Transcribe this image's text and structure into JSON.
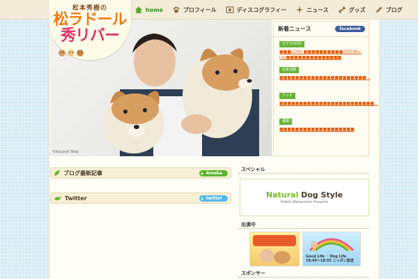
{
  "logo": {
    "sub": "松本秀樹の",
    "line1": "松ラドール",
    "line2": "秀リバー"
  },
  "nav": {
    "items": [
      {
        "label": "home",
        "icon": "home-icon"
      },
      {
        "label": "プロフィール",
        "icon": "paw-icon"
      },
      {
        "label": "ディスコグラフィー",
        "icon": "disc-icon"
      },
      {
        "label": "ニュース",
        "icon": "sparkle-icon"
      },
      {
        "label": "グッズ",
        "icon": "bone-icon"
      },
      {
        "label": "ブログ",
        "icon": "pencil-icon"
      }
    ]
  },
  "hero": {
    "credit": "©Kouyuki Tada"
  },
  "news": {
    "title": "新着ニュース",
    "facebook_label": "facebook",
    "items": [
      {
        "category": "ビデオ/DVD",
        "text": "■■■LOVE ■■■■■■■■■■DVD/Blu-ray■■■■■■■■■■■■■■"
      },
      {
        "category": "社会活動",
        "text": "■■■■■■■■■■■■■■■■■■■■■■..."
      },
      {
        "category": "テレビ",
        "text": "■■■■■■■■■■■■■■■■■■■■■■■■..."
      },
      {
        "category": "書籍",
        "text": "■■■■■■■■■■■■■■■■■■■"
      }
    ]
  },
  "blog": {
    "title": "ブログ最新記事",
    "button": "Ameba"
  },
  "twitter": {
    "title": "Twitter",
    "button": "twitter"
  },
  "special": {
    "label": "スペシャル",
    "banner_title_1": "Natural",
    "banner_title_2": " Dog Style",
    "banner_sub": "Hideki Matsumoto Presents"
  },
  "onair": {
    "label": "出演中",
    "b_caption": "Good Life ♡ Dog Life 18:45〜18:55 ニッポン放送"
  },
  "sponsor": {
    "label": "スポンサー"
  },
  "colors": {
    "accent_orange": "#f07a10",
    "accent_pink": "#e0306a",
    "nav_green": "#3d8a1e",
    "category_green": "#6bb33a",
    "facebook_blue": "#3b5998",
    "twitter_blue": "#56b7e8",
    "ameba_green": "#5cb531"
  }
}
